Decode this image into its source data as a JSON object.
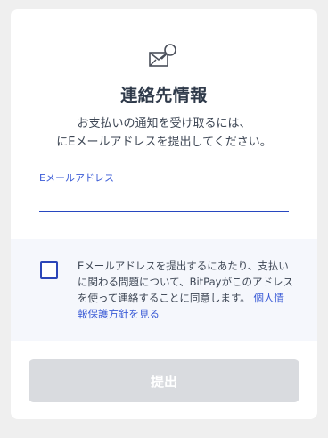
{
  "card": {
    "title": "連絡先情報",
    "description_line1": "お支払いの通知を受け取るには、",
    "description_line2": "にEメールアドレスを提出してください。"
  },
  "email": {
    "label": "Eメールアドレス",
    "value": "",
    "placeholder": ""
  },
  "consent": {
    "checked": false,
    "line1": "Eメールアドレスを提出するにあたり、支払い",
    "line2": "に関わる問題について、BitPayがこのアドレス",
    "line3": "を使って連絡することに同意します。",
    "link_part1": "個人情",
    "link_part2": "報保護方針を見る"
  },
  "submit": {
    "label": "提出",
    "disabled": true
  },
  "icons": {
    "header": "email-search-icon"
  },
  "colors": {
    "accent": "#3a5bd6",
    "input_underline": "#2847c0",
    "disabled_button": "#d9dbdf",
    "title": "#2f3a4a"
  }
}
